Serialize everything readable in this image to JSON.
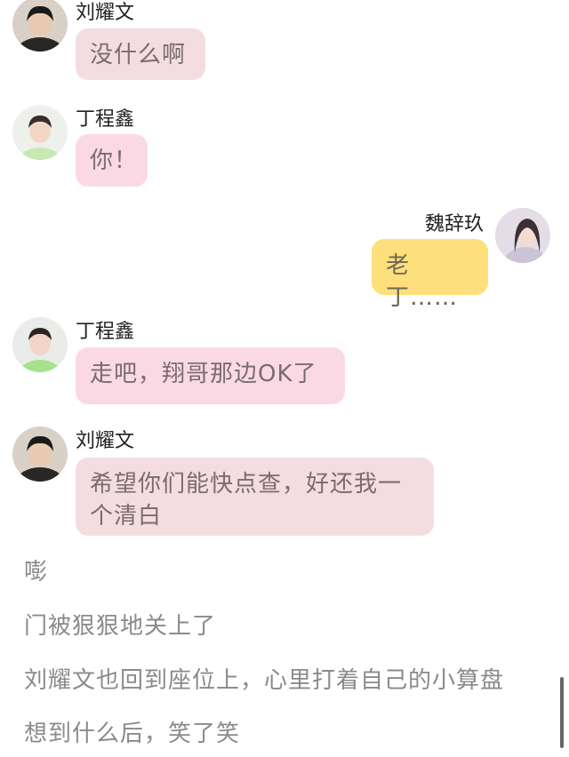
{
  "messages": [
    {
      "name": "刘耀文",
      "text": "没什么啊"
    },
    {
      "name": "丁程鑫",
      "text": "你！"
    },
    {
      "name": "魏辞玖",
      "text": "老丁……"
    },
    {
      "name": "丁程鑫",
      "text": "走吧，翔哥那边OK了"
    },
    {
      "name": "刘耀文",
      "text": "希望你们能快点查，好还我一个清白"
    }
  ],
  "narration": [
    "嘭",
    "门被狠狠地关上了",
    "刘耀文也回到座位上，心里打着自己的小算盘",
    "想到什么后，笑了笑"
  ],
  "colors": {
    "bubble_liu": "#f3dde1",
    "bubble_ding": "#fbd9e4",
    "bubble_wei": "#fde07c"
  }
}
